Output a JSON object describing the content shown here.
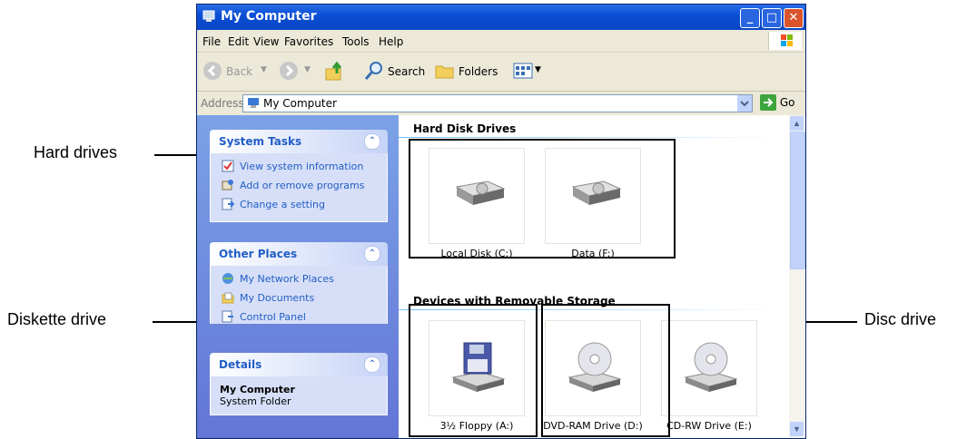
{
  "callouts": {
    "hard_drives": "Hard drives",
    "diskette_drive": "Diskette drive",
    "disc_drive": "Disc drive"
  },
  "window": {
    "title": "My Computer",
    "menu": [
      "File",
      "Edit",
      "View",
      "Favorites",
      "Tools",
      "Help"
    ],
    "toolbar": {
      "back": "Back",
      "search": "Search",
      "folders": "Folders"
    },
    "address": {
      "label": "Address",
      "value": "My Computer",
      "go": "Go"
    }
  },
  "sidebar": {
    "system_tasks": {
      "title": "System Tasks",
      "items": [
        "View system information",
        "Add or remove programs",
        "Change a setting"
      ]
    },
    "other_places": {
      "title": "Other Places",
      "items": [
        "My Network Places",
        "My Documents",
        "Control Panel"
      ]
    },
    "details": {
      "title": "Details",
      "name": "My Computer",
      "type": "System Folder"
    }
  },
  "content": {
    "hard_disk_section": "Hard Disk Drives",
    "removable_section": "Devices with Removable Storage",
    "hard_drives": [
      "Local Disk (C:)",
      "Data (F:)"
    ],
    "removable": [
      "3½ Floppy (A:)",
      "DVD-RAM Drive (D:)",
      "CD-RW Drive (E:)"
    ]
  },
  "icons": {
    "title": "my-computer-icon",
    "disk": "hard-disk-icon",
    "floppy": "floppy-drive-icon",
    "cd": "cd-drive-icon"
  }
}
